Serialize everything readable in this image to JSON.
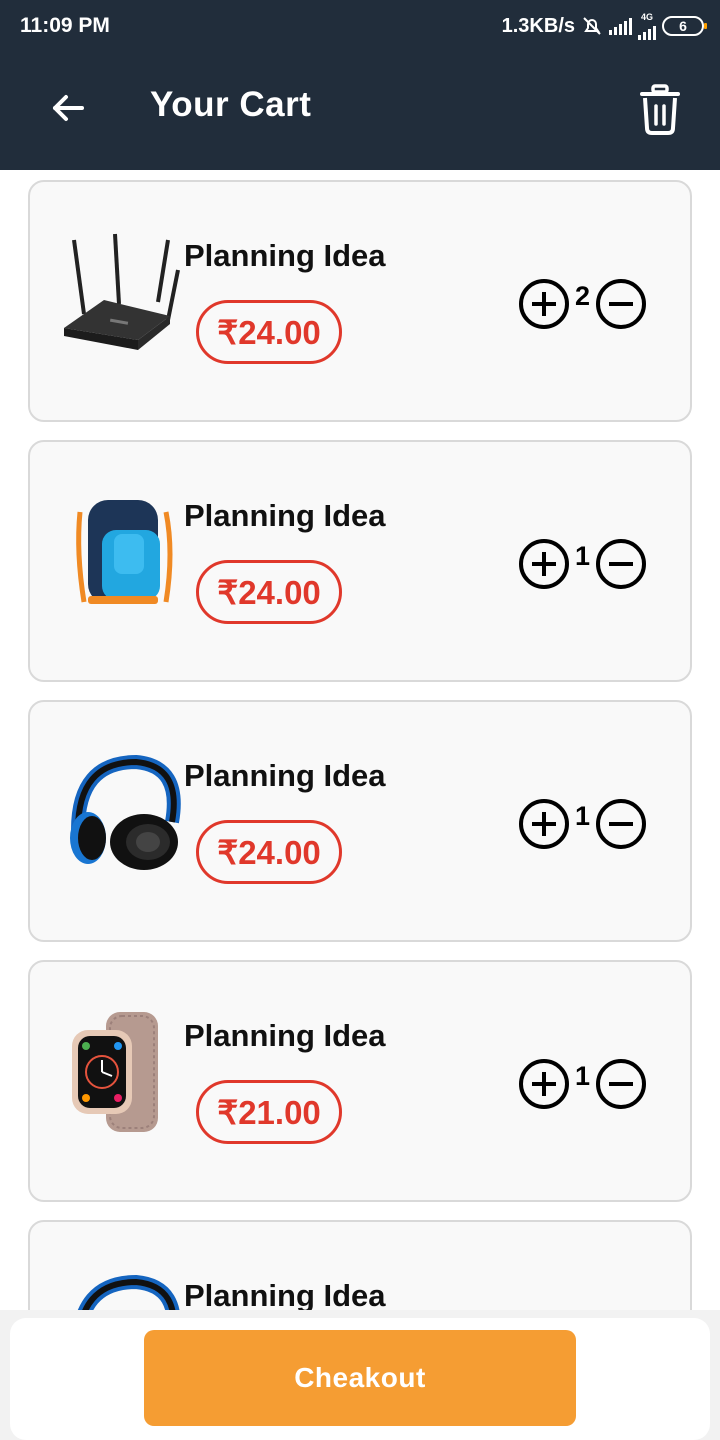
{
  "status_bar": {
    "time": "11:09 PM",
    "network_speed": "1.3KB/s",
    "network_type": "4G",
    "battery_level": "6"
  },
  "app_bar": {
    "title": "Your Cart",
    "back_icon": "arrow-left-icon",
    "delete_icon": "trash-icon"
  },
  "cart": {
    "items": [
      {
        "name": "Planning Idea",
        "price": "₹24.00",
        "quantity": "2",
        "image": "wifi-router-image"
      },
      {
        "name": "Planning Idea",
        "price": "₹24.00",
        "quantity": "1",
        "image": "backpack-image"
      },
      {
        "name": "Planning Idea",
        "price": "₹24.00",
        "quantity": "1",
        "image": "headphones-image"
      },
      {
        "name": "Planning Idea",
        "price": "₹21.00",
        "quantity": "1",
        "image": "smartwatch-image"
      },
      {
        "name": "Planning Idea",
        "image": "headphones-image"
      }
    ]
  },
  "footer": {
    "checkout_label": "Cheakout"
  },
  "colors": {
    "header_bg": "#212d3b",
    "price_red": "#e0382b",
    "checkout_orange": "#f59d33",
    "card_bg": "#f9f9f9"
  }
}
